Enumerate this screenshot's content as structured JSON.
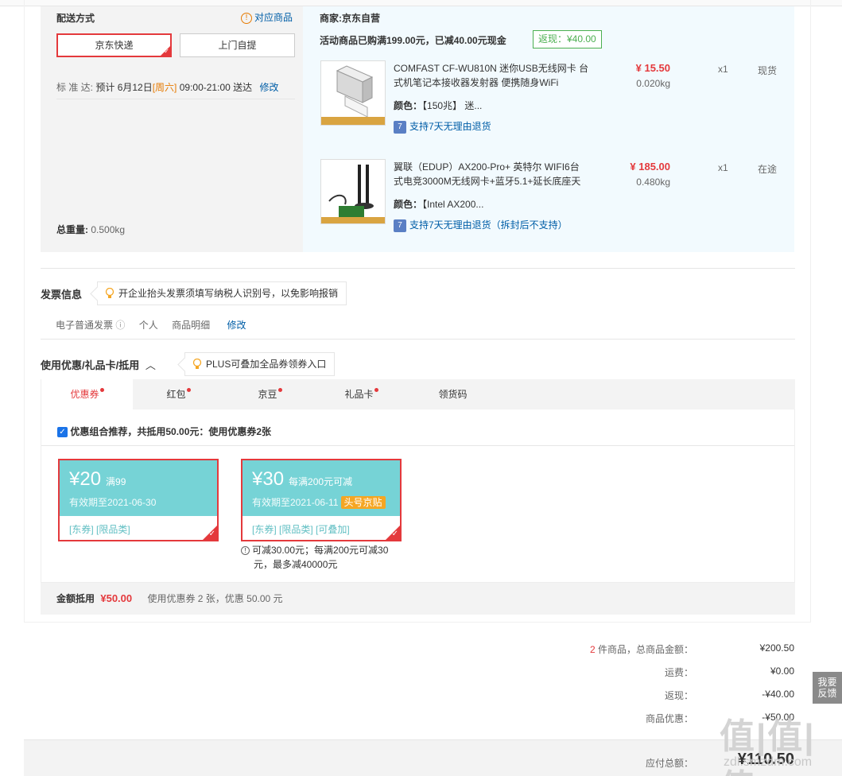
{
  "shipping": {
    "title": "配送方式",
    "related_link": "对应商品",
    "option_express": "京东快递",
    "option_pickup": "上门自提",
    "standard_label": "标 准 达:",
    "eta_prefix": "预计 6月12日",
    "eta_weekday": "[周六]",
    "eta_time": "09:00-21:00 送达",
    "modify": "修改",
    "total_weight_label": "总重量:",
    "total_weight_value": "0.500kg"
  },
  "merchant": {
    "label": "商家:",
    "name": "京东自营",
    "promo_text": "活动商品已购满199.00元，已减40.00元现金",
    "rebate_tag": "返现：¥40.00"
  },
  "items": [
    {
      "title_line1": "COMFAST CF-WU810N 迷你USB无线网卡 台",
      "title_line2": "式机笔记本接收器发射器 便携随身WiFi",
      "color_label": "颜色：",
      "color_value": "【150兆】 迷...",
      "return_policy": "支持7天无理由退货",
      "price": "¥ 15.50",
      "weight": "0.020kg",
      "qty": "x1",
      "stock": "现货"
    },
    {
      "title_line1": "翼联（EDUP）AX200-Pro+ 英特尔 WIFI6台",
      "title_line2": "式电竞3000M无线网卡+蓝牙5.1+延长底座天",
      "color_label": "颜色：",
      "color_value": "【Intel AX200...",
      "return_policy": "支持7天无理由退货（拆封后不支持）",
      "price": "¥ 185.00",
      "weight": "0.480kg",
      "qty": "x1",
      "stock": "在途"
    }
  ],
  "invoice": {
    "title": "发票信息",
    "tip": "开企业抬头发票须填写纳税人识别号，以免影响报销",
    "type": "电子普通发票",
    "info_icon": "ⓘ",
    "title_type": "个人",
    "content": "商品明细",
    "modify": "修改"
  },
  "discount": {
    "title": "使用优惠/礼品卡/抵用",
    "toggle": "︿",
    "tip": "PLUS可叠加全品券领券入口",
    "tabs": [
      "优惠券",
      "红包",
      "京豆",
      "礼品卡",
      "领货码"
    ],
    "recommend_text": "优惠组合推荐，共抵用50.00元：使用优惠券2张",
    "coupons": [
      {
        "amount": "¥20",
        "condition": "满99",
        "valid": "有效期至2021-06-30",
        "badge": "",
        "tags": "[东券]   [限品类]"
      },
      {
        "amount": "¥30",
        "condition": "每满200元可减",
        "valid": "有效期至2021-06-11",
        "badge": "头号京贴",
        "tags": "[东券]   [限品类]   [可叠加]"
      }
    ],
    "coupon2_note_line1": "可减30.00元；每满200元可减30",
    "coupon2_note_line2": "元，最多减40000元",
    "summary_label": "金额抵用",
    "summary_amount": "¥50.00",
    "summary_detail": "使用优惠券 2 张，优惠 50.00 元"
  },
  "totals": {
    "count": "2",
    "count_suffix": " 件商品，总商品金额：",
    "goods_amount": "¥200.50",
    "shipping_label": "运费：",
    "shipping_value": "¥0.00",
    "rebate_label": "返现：",
    "rebate_value": "-¥40.00",
    "discount_label": "商品优惠：",
    "discount_value": "-¥50.00",
    "payable_label": "应付总额：",
    "payable_value": "¥110.50"
  },
  "feedback": {
    "line1": "我要",
    "line2": "反馈"
  },
  "watermark": {
    "logo": "值|值|值",
    "url": "zdl.smzdm.com"
  },
  "colors": {
    "accent": "#e4393c",
    "link": "#005ea7",
    "coupon": "#76d3d6",
    "green": "#4caf50"
  }
}
